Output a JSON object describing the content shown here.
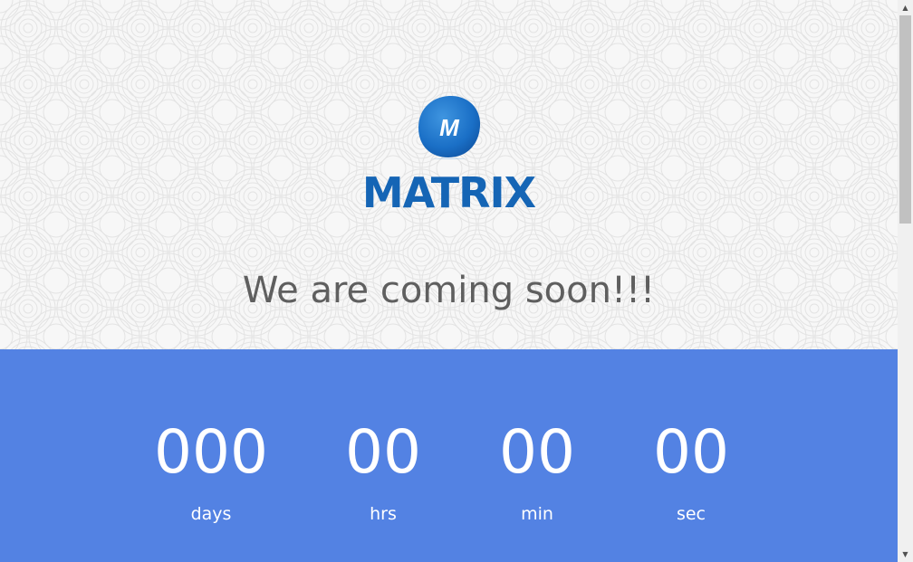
{
  "brand": {
    "logo_letter": "M",
    "name": "MATRIX",
    "color": "#1565b5"
  },
  "hero": {
    "tagline": "We are coming soon!!!"
  },
  "countdown": {
    "background": "#5382e3",
    "units": [
      {
        "value": "000",
        "label": "days"
      },
      {
        "value": "00",
        "label": "hrs"
      },
      {
        "value": "00",
        "label": "min"
      },
      {
        "value": "00",
        "label": "sec"
      }
    ]
  },
  "scrollbar": {
    "up_icon": "triangle-up-icon",
    "down_icon": "triangle-down-icon"
  }
}
